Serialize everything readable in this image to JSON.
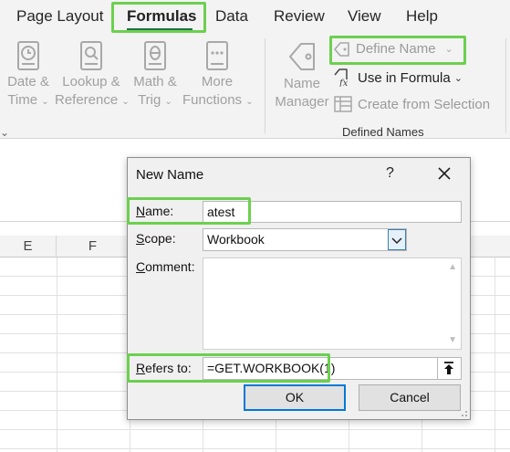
{
  "ribbon": {
    "tabs": [
      {
        "label": "Page Layout"
      },
      {
        "label": "Formulas"
      },
      {
        "label": "Data"
      },
      {
        "label": "Review"
      },
      {
        "label": "View"
      },
      {
        "label": "Help"
      }
    ],
    "buttons": [
      {
        "line1": "Date &",
        "line2": "Time"
      },
      {
        "line1": "Lookup &",
        "line2": "Reference"
      },
      {
        "line1": "Math &",
        "line2": "Trig"
      },
      {
        "line1": "More",
        "line2": "Functions"
      },
      {
        "line1": "Name",
        "line2": "Manager"
      }
    ],
    "define_name": "Define Name",
    "use_in_formula": "Use in Formula",
    "create_from_selection": "Create from Selection",
    "group_defined_names": "Defined Names"
  },
  "sheet": {
    "columns": [
      "E",
      "F"
    ]
  },
  "dialog": {
    "title": "New Name",
    "help": "?",
    "name_label_key": "N",
    "name_label_rest": "ame:",
    "name_value": "atest",
    "scope_label_key": "S",
    "scope_label_rest": "cope:",
    "scope_value": "Workbook",
    "comment_label_key": "C",
    "comment_label_rest": "omment:",
    "comment_value": "",
    "refers_label_key": "R",
    "refers_label_rest": "efers to:",
    "refers_value": "=GET.WORKBOOK(1)",
    "ok_label": "OK",
    "cancel_label": "Cancel"
  },
  "colors": {
    "highlight": "#6cd04f",
    "excel_green": "#1e7145",
    "default_button_border": "#0078d7"
  }
}
